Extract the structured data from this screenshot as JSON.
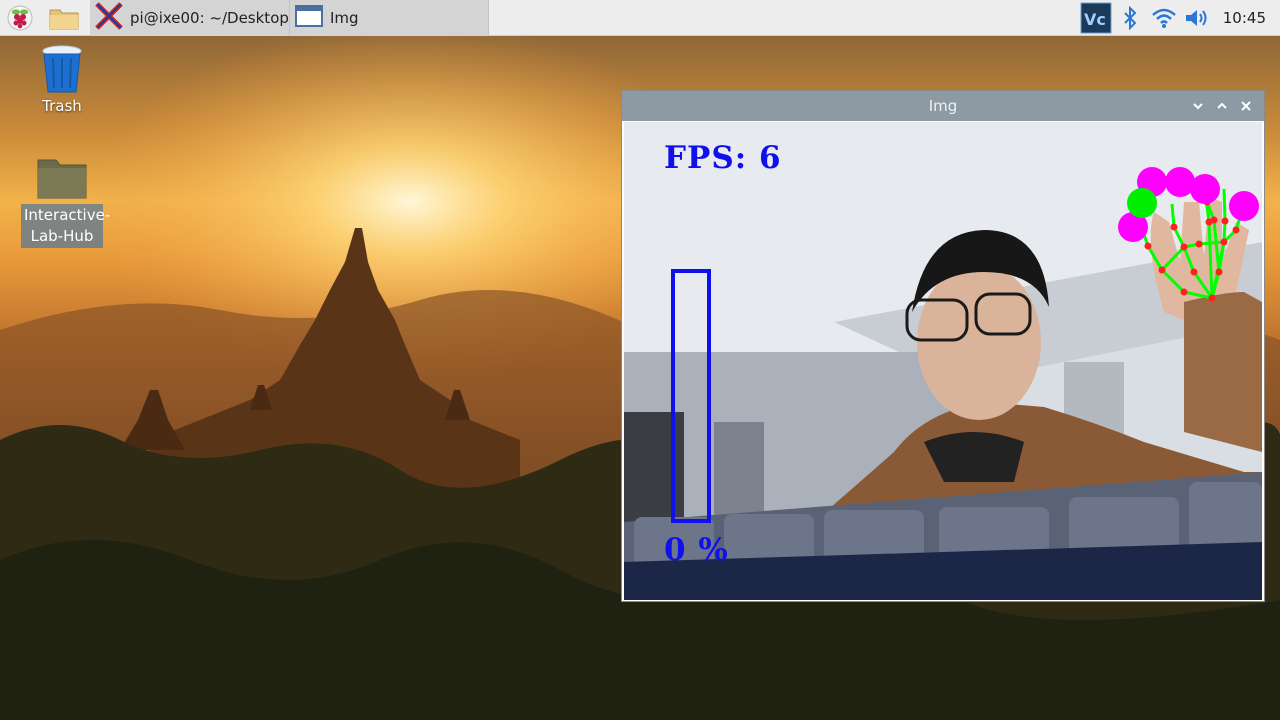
{
  "taskbar": {
    "launcher_icon": "raspberry-menu-icon",
    "file_manager_icon": "folder-icon",
    "tasks": [
      {
        "label": "pi@ixe00: ~/Desktop...",
        "icon": "x-terminal-icon"
      },
      {
        "label": "Img",
        "icon": "window-icon"
      }
    ],
    "tray": {
      "vnc_icon": "vnc-icon",
      "bluetooth_icon": "bluetooth-icon",
      "wifi_icon": "wifi-icon",
      "volume_icon": "volume-icon",
      "clock": "10:45"
    }
  },
  "desktop": {
    "icons": [
      {
        "label": "Trash",
        "icon": "trash-icon"
      },
      {
        "label": "Interactive-Lab-Hub",
        "icon": "folder-icon"
      }
    ]
  },
  "window": {
    "title": "Img",
    "controls": [
      "minimize",
      "maximize",
      "close"
    ],
    "overlay": {
      "fps_text": "FPS: 6",
      "volume_percent_text": "0 %",
      "volume_level": 0,
      "bar_color": "#1010ee",
      "landmark_color": "#ff00ff",
      "thumb_color": "#00ee00",
      "skeleton_color": "#00ff00",
      "joint_color": "#ff0000"
    }
  },
  "colors": {
    "taskbar_bg": "#ededed",
    "active_task_bg": "#d4d4d4",
    "window_title_bg": "#8e9aa3",
    "vnc_bg": "#1c3a5a"
  }
}
